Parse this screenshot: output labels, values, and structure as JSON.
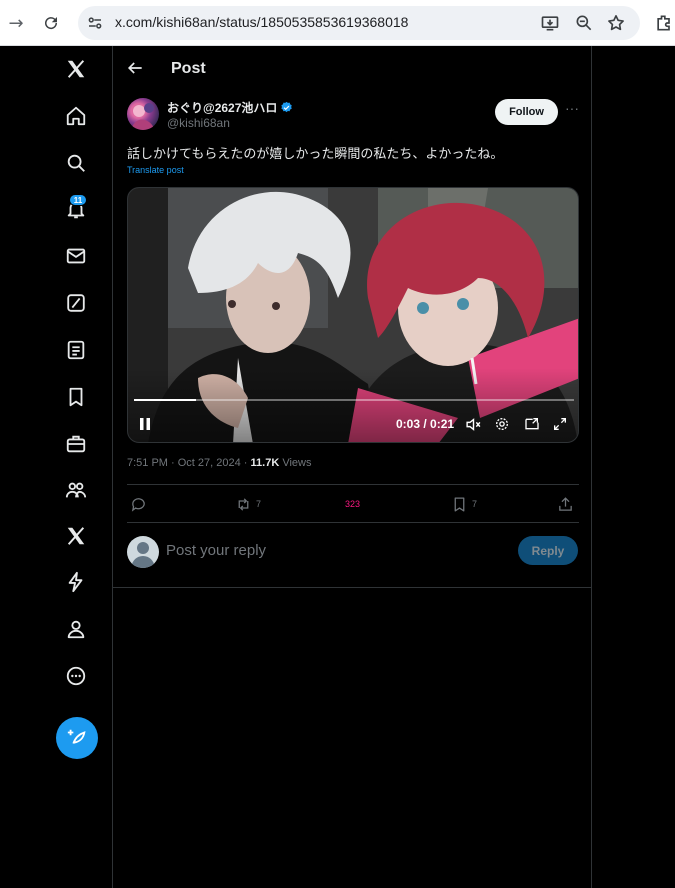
{
  "browser": {
    "url": "x.com/kishi68an/status/1850535853619368018"
  },
  "nav": {
    "notification_count": "11"
  },
  "header": {
    "title": "Post"
  },
  "post": {
    "display_name": "おぐり@2627池ハロ",
    "handle": "@kishi68an",
    "follow_label": "Follow",
    "text": "話しかけてもらえたのが嬉しかった瞬間の私たち、よかったね。",
    "translate_label": "Translate post",
    "video": {
      "time": "0:03 / 0:21",
      "progress": 0.14
    },
    "timestamp": "7:51 PM · Oct 27, 2024 · ",
    "views_count": "11.7K",
    "views_label": " Views",
    "actions": {
      "retweets": "7",
      "likes": "323",
      "bookmarks": "7"
    }
  },
  "reply": {
    "placeholder": "Post your reply",
    "button_label": "Reply"
  },
  "colors": {
    "accent": "#1d9bf0",
    "like": "#f91880",
    "background": "#000000"
  }
}
